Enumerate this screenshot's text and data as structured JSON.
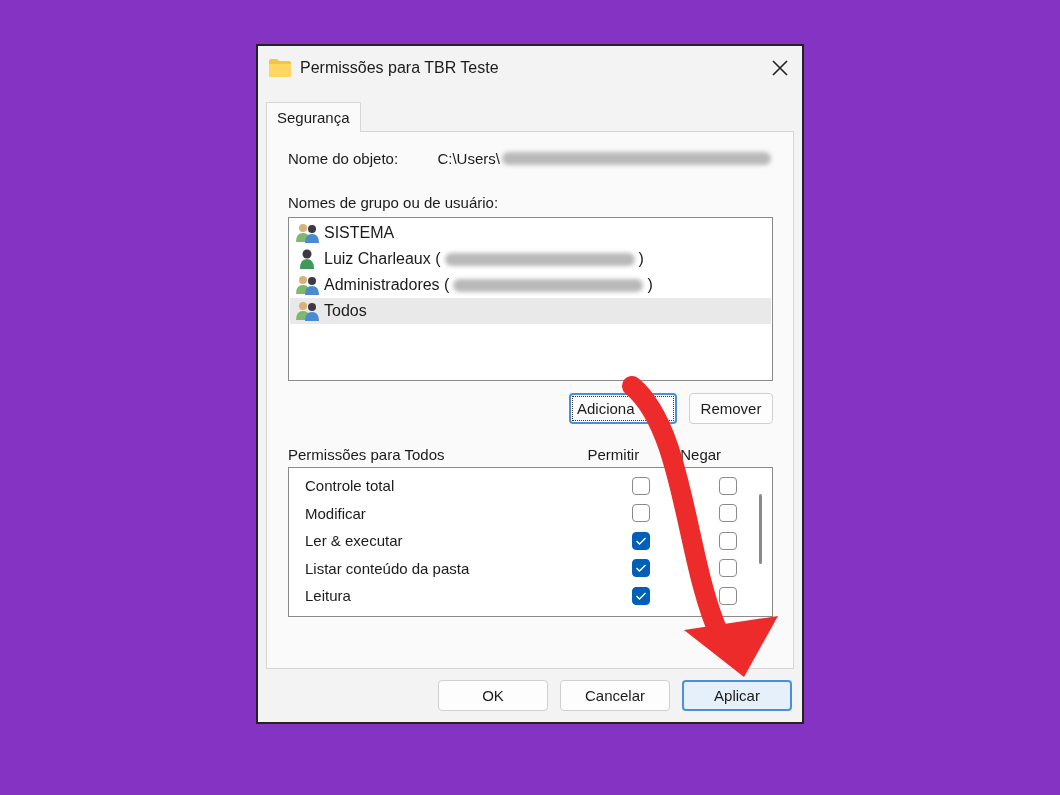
{
  "window": {
    "title": "Permissões para TBR Teste"
  },
  "tabs": [
    {
      "label": "Segurança",
      "selected": true
    }
  ],
  "object": {
    "label": "Nome do objeto:",
    "value": "C:\\Users\\",
    "redacted": true
  },
  "groups": {
    "label": "Nomes de grupo ou de usuário:",
    "items": [
      {
        "name": "SISTEMA",
        "kind": "group",
        "redacted": false,
        "selected": false
      },
      {
        "name": "Luiz Charleaux (",
        "kind": "user",
        "suffix": ")",
        "redacted": true,
        "selected": false
      },
      {
        "name": "Administradores (",
        "kind": "group",
        "suffix": ")",
        "redacted": true,
        "selected": false
      },
      {
        "name": "Todos",
        "kind": "group",
        "redacted": false,
        "selected": true
      }
    ]
  },
  "group_buttons": [
    {
      "label": "Adiciona",
      "focused": true
    },
    {
      "label": "Remover",
      "focused": false
    }
  ],
  "permissions": {
    "title": "Permissões para Todos",
    "allow_label": "Permitir",
    "deny_label": "Negar",
    "rows": [
      {
        "name": "Controle total",
        "allow": false,
        "deny": false
      },
      {
        "name": "Modificar",
        "allow": false,
        "deny": false
      },
      {
        "name": "Ler & executar",
        "allow": true,
        "deny": false
      },
      {
        "name": "Listar conteúdo da pasta",
        "allow": true,
        "deny": false
      },
      {
        "name": "Leitura",
        "allow": true,
        "deny": false
      }
    ]
  },
  "buttons": [
    {
      "label": "OK",
      "default": false
    },
    {
      "label": "Cancelar",
      "default": false
    },
    {
      "label": "Aplicar",
      "default": true
    }
  ]
}
